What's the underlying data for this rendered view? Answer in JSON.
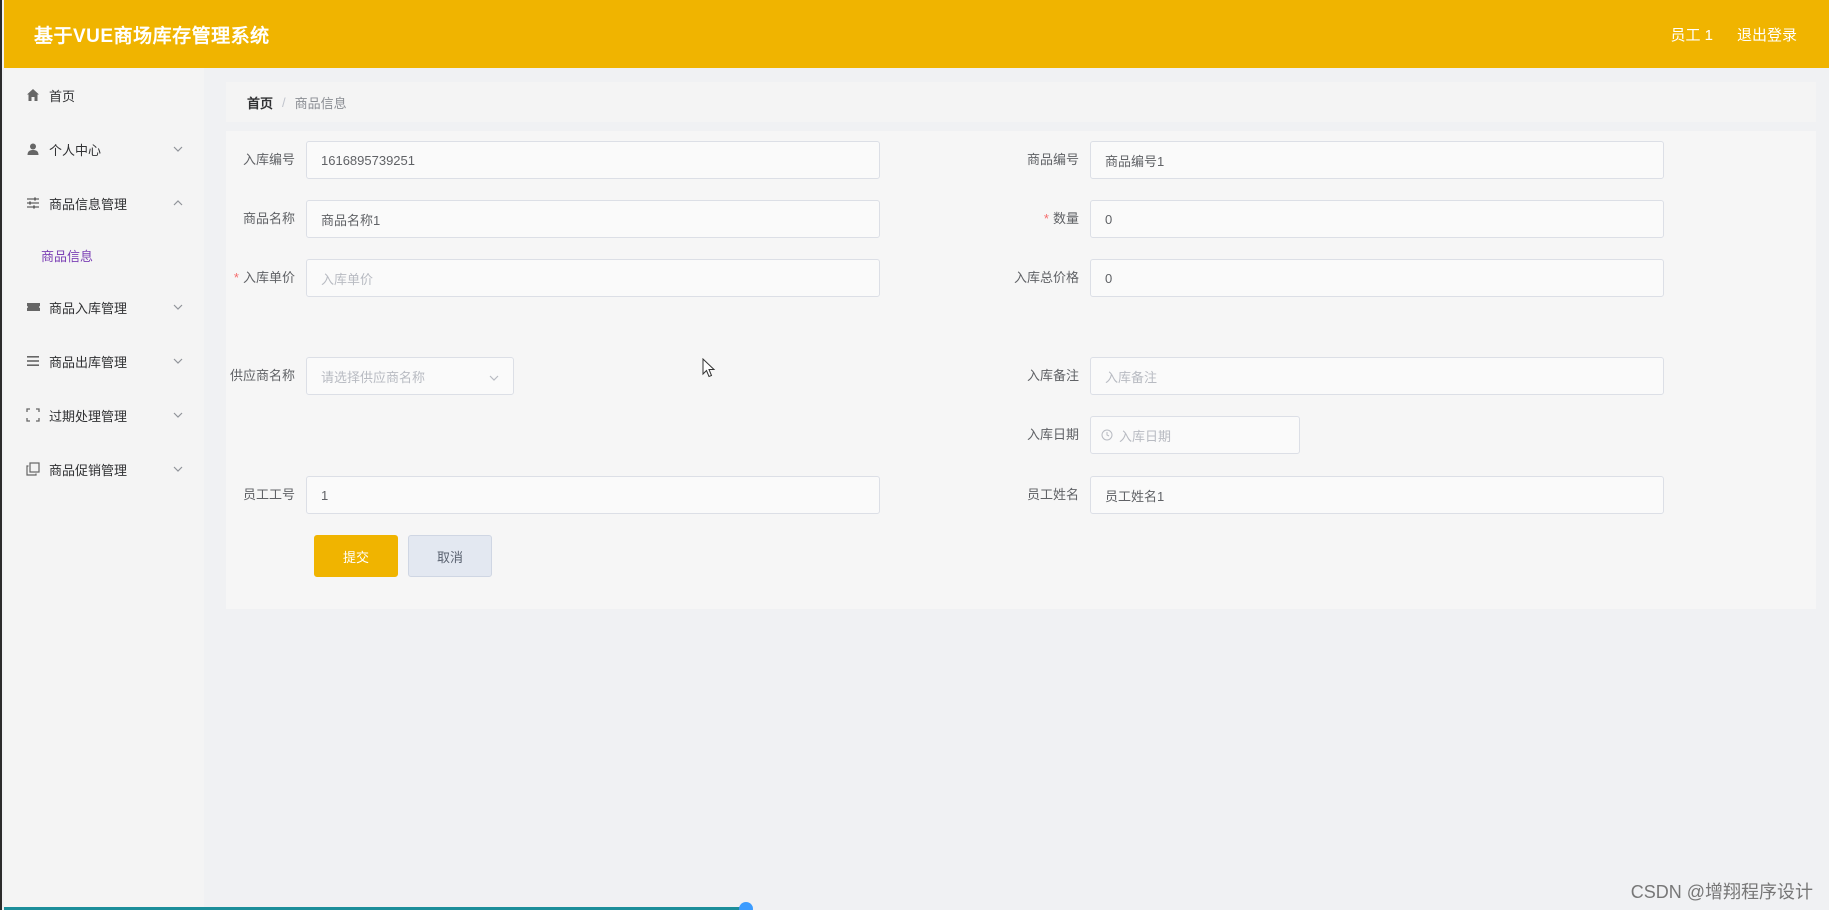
{
  "header": {
    "app_title": "基于VUE商场库存管理系统",
    "user_label": "员工 1",
    "logout_label": "退出登录"
  },
  "sidebar": {
    "items": [
      {
        "label": "首页",
        "icon": "home-icon"
      },
      {
        "label": "个人中心",
        "icon": "user-icon",
        "expandable": true
      },
      {
        "label": "商品信息管理",
        "icon": "sliders-icon",
        "expanded": true,
        "children": [
          {
            "label": "商品信息"
          }
        ]
      },
      {
        "label": "商品入库管理",
        "icon": "ticket-icon",
        "expandable": true
      },
      {
        "label": "商品出库管理",
        "icon": "list-icon",
        "expandable": true
      },
      {
        "label": "过期处理管理",
        "icon": "fullscreen-icon",
        "expandable": true
      },
      {
        "label": "商品促销管理",
        "icon": "copy-icon",
        "expandable": true
      }
    ]
  },
  "breadcrumb": {
    "home": "首页",
    "separator": "/",
    "current": "商品信息"
  },
  "form": {
    "inbound_no": {
      "label": "入库编号",
      "value": "1616895739251"
    },
    "goods_no": {
      "label": "商品编号",
      "value": "商品编号1"
    },
    "goods_name": {
      "label": "商品名称",
      "value": "商品名称1"
    },
    "quantity": {
      "label": "数量",
      "value": "0",
      "required": true
    },
    "unit_price": {
      "label": "入库单价",
      "placeholder": "入库单价",
      "required": true
    },
    "total_price": {
      "label": "入库总价格",
      "value": "0"
    },
    "supplier": {
      "label": "供应商名称",
      "placeholder": "请选择供应商名称"
    },
    "remark": {
      "label": "入库备注",
      "placeholder": "入库备注"
    },
    "date": {
      "label": "入库日期",
      "placeholder": "入库日期"
    },
    "staff_no": {
      "label": "员工工号",
      "value": "1"
    },
    "staff_name": {
      "label": "员工姓名",
      "value": "员工姓名1"
    },
    "required_mark": "*"
  },
  "buttons": {
    "submit": "提交",
    "cancel": "取消"
  },
  "watermark": "CSDN @增翔程序设计",
  "colors": {
    "accent": "#f0b400",
    "active_menu": "#7b3fb5",
    "required": "#f56c6c"
  }
}
